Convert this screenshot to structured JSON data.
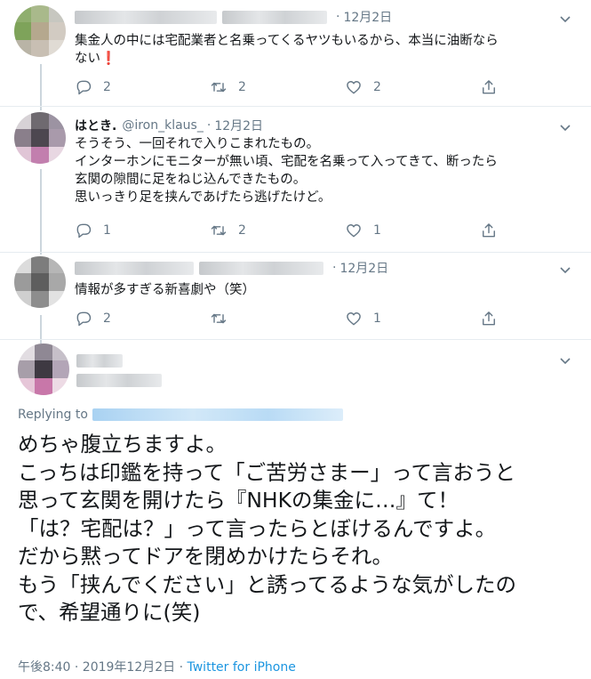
{
  "tweets": [
    {
      "date": "12月2日",
      "lines": [
        "集金人の中には宅配業者と名乗ってくるヤツもいるから、本当に油断なら",
        "ない"
      ],
      "emoji": "❗",
      "counts": {
        "reply": "2",
        "retweet": "2",
        "like": "2"
      }
    },
    {
      "name": "はとき.",
      "handle": "@iron_klaus_",
      "date": "12月2日",
      "lines": [
        "そうそう、一回それで入りこまれたもの。",
        "インターホンにモニターが無い頃、宅配を名乗って入ってきて、断ったら",
        "玄関の隙間に足をねじ込んできたもの。",
        "思いっきり足を挟んであげたら逃げたけど。"
      ],
      "counts": {
        "reply": "1",
        "retweet": "2",
        "like": "1"
      }
    },
    {
      "date": "12月2日",
      "lines": [
        "情報が多すぎる新喜劇や（笑）"
      ],
      "counts": {
        "reply": "2",
        "retweet": "",
        "like": "1"
      }
    }
  ],
  "main_tweet": {
    "replying_label": "Replying to",
    "lines": [
      "めちゃ腹立ちますよ。",
      "こっちは印鑑を持って「ご苦労さまー」って言おうと",
      "思って玄関を開けたら『NHKの集金に…』て！",
      "「は？宅配は？」って言ったらとぼけるんですよ。",
      "だから黙ってドアを閉めかけたらそれ。",
      "もう「挟んでください」と誘ってるような気がしたの",
      "で、希望通りに(笑)"
    ],
    "timestamp": "午後8:40 · 2019年12月2日 · ",
    "source": "Twitter for iPhone"
  },
  "icons": {
    "reply": "reply-icon",
    "retweet": "retweet-icon",
    "like": "like-icon",
    "share": "share-icon",
    "caret": "chevron-down-icon"
  },
  "colors": {
    "text": "#14171a",
    "secondary": "#657786",
    "link": "#1b95e0",
    "divider": "#e6ecf0",
    "thread_line": "#ccd6dd",
    "emoji_red": "#e0245e"
  }
}
